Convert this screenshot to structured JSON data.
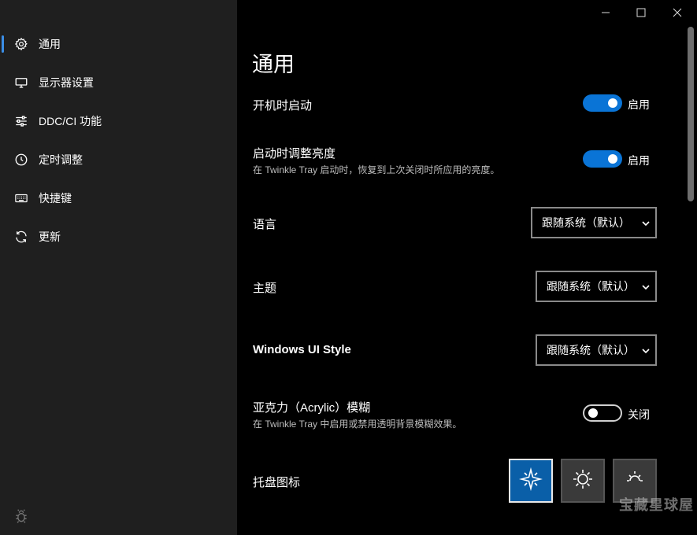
{
  "sidebar": {
    "items": [
      {
        "label": "通用",
        "icon": "gear-icon",
        "active": true
      },
      {
        "label": "显示器设置",
        "icon": "monitor-icon",
        "active": false
      },
      {
        "label": "DDC/CI 功能",
        "icon": "sliders-icon",
        "active": false
      },
      {
        "label": "定时调整",
        "icon": "clock-icon",
        "active": false
      },
      {
        "label": "快捷键",
        "icon": "keyboard-icon",
        "active": false
      },
      {
        "label": "更新",
        "icon": "refresh-icon",
        "active": false
      }
    ],
    "footer_icon": "bug-icon"
  },
  "window_controls": [
    "minimize-icon",
    "maximize-icon",
    "close-icon"
  ],
  "main": {
    "title": "通用",
    "settings": {
      "startup": {
        "label": "开机时启动",
        "state": "启用",
        "on": true
      },
      "restore_brightness": {
        "label": "启动时调整亮度",
        "description": "在 Twinkle Tray 启动时，恢复到上次关闭时所应用的亮度。",
        "state": "启用",
        "on": true
      },
      "language": {
        "label": "语言",
        "value": "跟随系统（默认）"
      },
      "theme": {
        "label": "主题",
        "value": "跟随系统（默认）"
      },
      "ui_style": {
        "label": "Windows UI Style",
        "value": "跟随系统（默认）"
      },
      "acrylic": {
        "label": "亚克力（Acrylic）模糊",
        "description": "在 Twinkle Tray 中启用或禁用透明背景模糊效果。",
        "state": "关闭",
        "on": false
      },
      "tray_icon": {
        "label": "托盘图标",
        "options": [
          "sparkle-icon",
          "sun-icon",
          "sun-outline-icon"
        ],
        "selected_index": 0
      }
    }
  },
  "watermark": "宝藏星球屋",
  "colors": {
    "accent": "#0a74d6",
    "sidebar_bg": "#1f1f1f",
    "main_bg": "#000000"
  }
}
